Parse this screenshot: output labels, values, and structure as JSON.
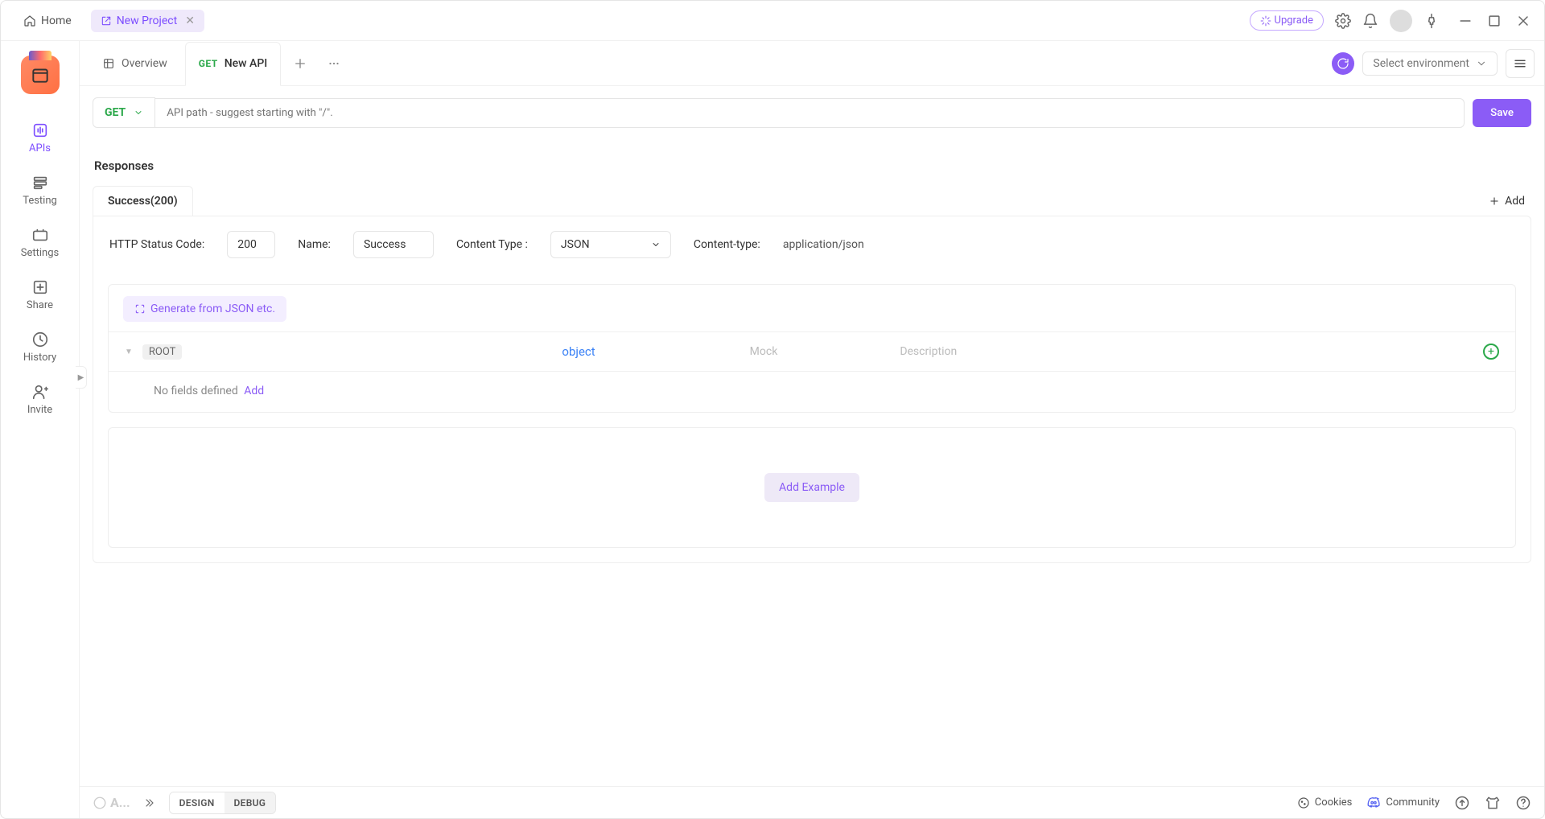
{
  "titlebar": {
    "home": "Home",
    "project_tab": "New Project",
    "upgrade": "Upgrade"
  },
  "leftbar": {
    "apis": "APIs",
    "testing": "Testing",
    "settings": "Settings",
    "share": "Share",
    "history": "History",
    "invite": "Invite"
  },
  "tabs": {
    "overview": "Overview",
    "api_method": "GET",
    "api_name": "New API",
    "env_placeholder": "Select environment"
  },
  "request": {
    "method": "GET",
    "url_placeholder": "API path - suggest starting with \"/\".",
    "save": "Save"
  },
  "responses": {
    "heading": "Responses",
    "tab_label": "Success(200)",
    "add": "Add",
    "status_label": "HTTP Status Code:",
    "status_value": "200",
    "name_label": "Name:",
    "name_value": "Success",
    "content_type_label": "Content Type :",
    "content_type_value": "JSON",
    "header_label": "Content-type:",
    "header_value": "application/json",
    "generate": "Generate from JSON etc.",
    "root": "ROOT",
    "type": "object",
    "mock": "Mock",
    "description": "Description",
    "nofields": "No fields defined",
    "addfield": "Add",
    "add_example": "Add Example"
  },
  "statusbar": {
    "design": "DESIGN",
    "debug": "DEBUG",
    "cookies": "Cookies",
    "community": "Community"
  }
}
